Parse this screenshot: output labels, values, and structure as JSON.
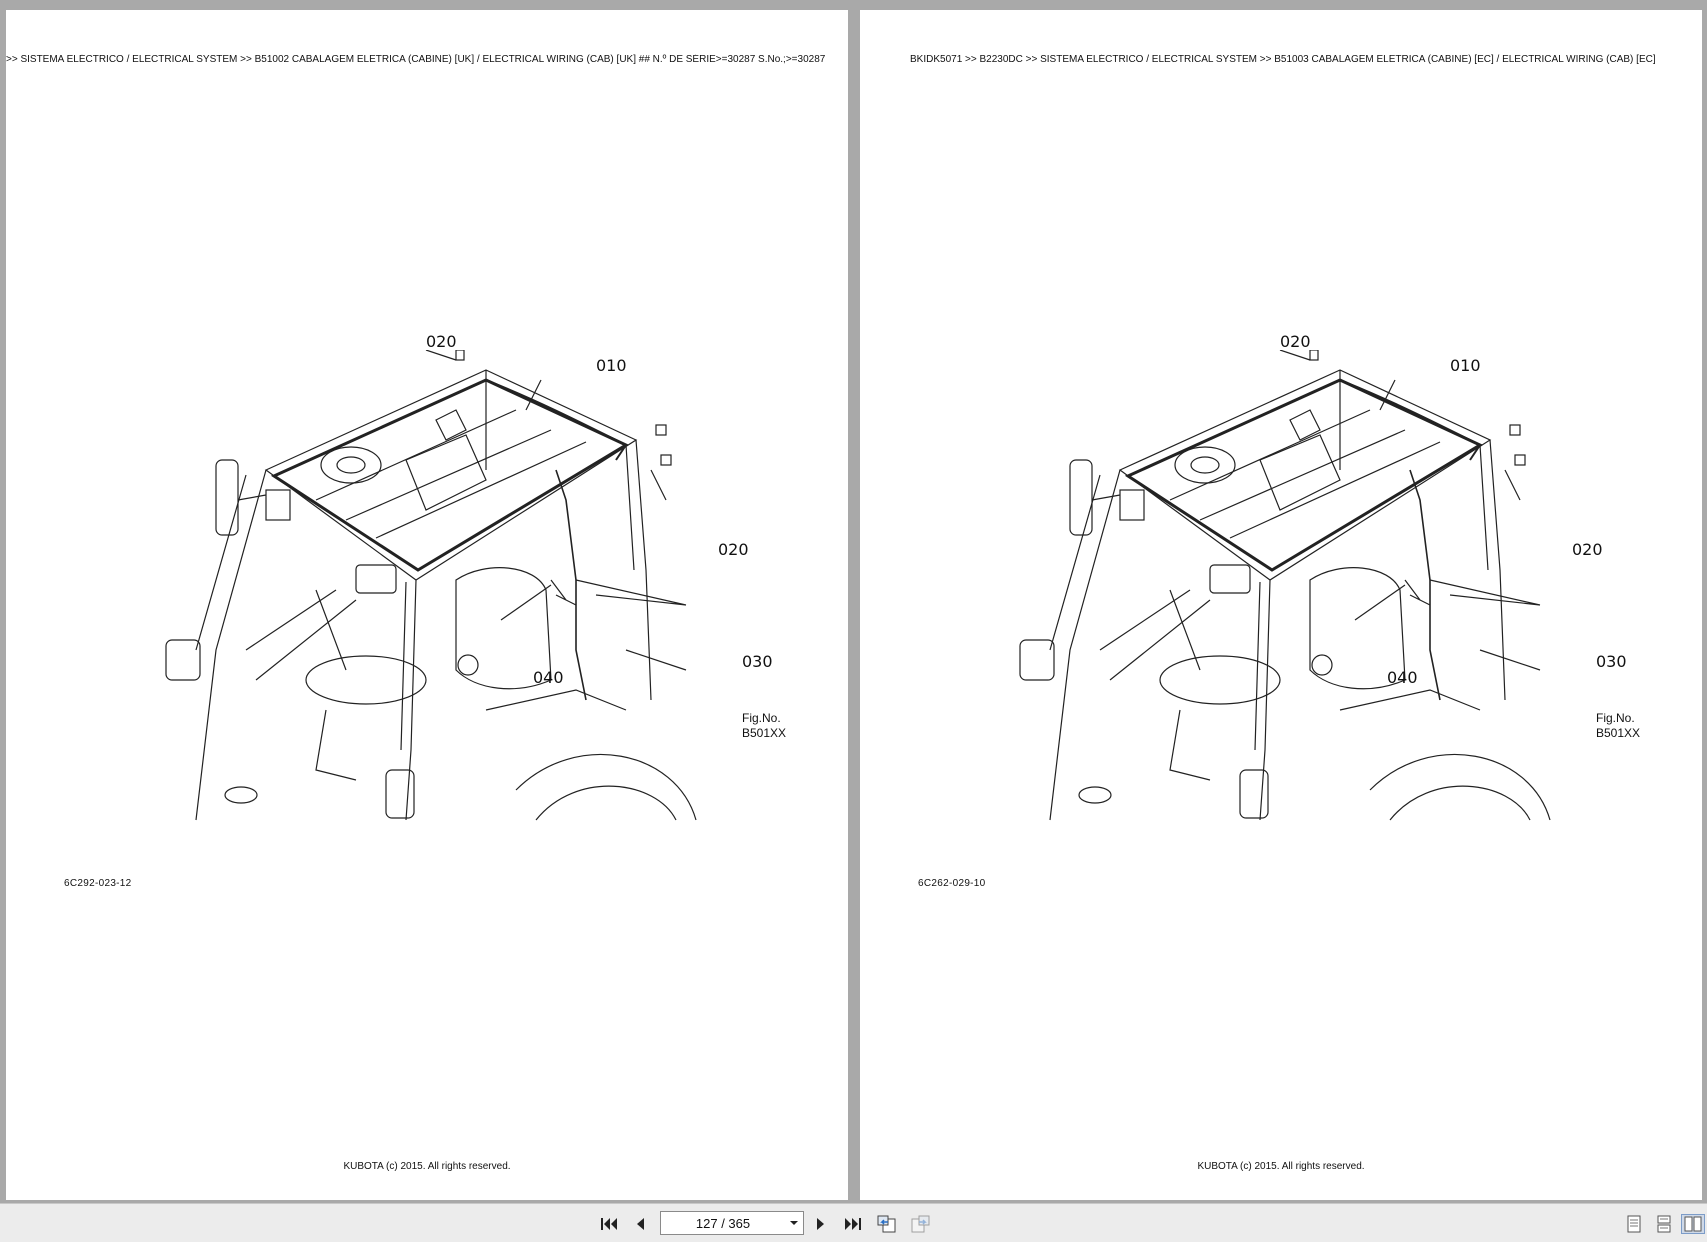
{
  "pages": [
    {
      "breadcrumb": ">> SISTEMA ELÉCTRICO / ELECTRICAL SYSTEM >> B51002   CABALAGEM ELETRICA (CABINE) [UK] / ELECTRICAL WIRING (CAB) [UK] ## N.º DE SÉRIE>=30287 S.No.;>=30287",
      "callouts": {
        "c010": "010",
        "c020a": "020",
        "c020b": "020",
        "c030": "030",
        "c040": "040"
      },
      "fig_no_label": "Fig.No.",
      "fig_no_value": "B501XX",
      "figure_code": "6C292-023-12",
      "copyright": "KUBOTA (c) 2015. All rights reserved."
    },
    {
      "breadcrumb": "BKIDK5071 >> B2230DC >> SISTEMA ELÉCTRICO / ELECTRICAL SYSTEM >> B51003   CABALAGEM ELETRICA (CABINE) [EC] / ELECTRICAL WIRING (CAB) [EC]",
      "callouts": {
        "c010": "010",
        "c020a": "020",
        "c020b": "020",
        "c030": "030",
        "c040": "040"
      },
      "fig_no_label": "Fig.No.",
      "fig_no_value": "B501XX",
      "figure_code": "6C262-029-10",
      "copyright": "KUBOTA (c) 2015. All rights reserved."
    }
  ],
  "toolbar": {
    "page_indicator": "127 / 365",
    "icons": [
      "first-page-icon",
      "previous-page-icon",
      "next-page-icon",
      "last-page-icon",
      "previous-view-icon",
      "next-view-icon",
      "single-page-view-icon",
      "continuous-view-icon",
      "two-page-view-icon"
    ]
  }
}
